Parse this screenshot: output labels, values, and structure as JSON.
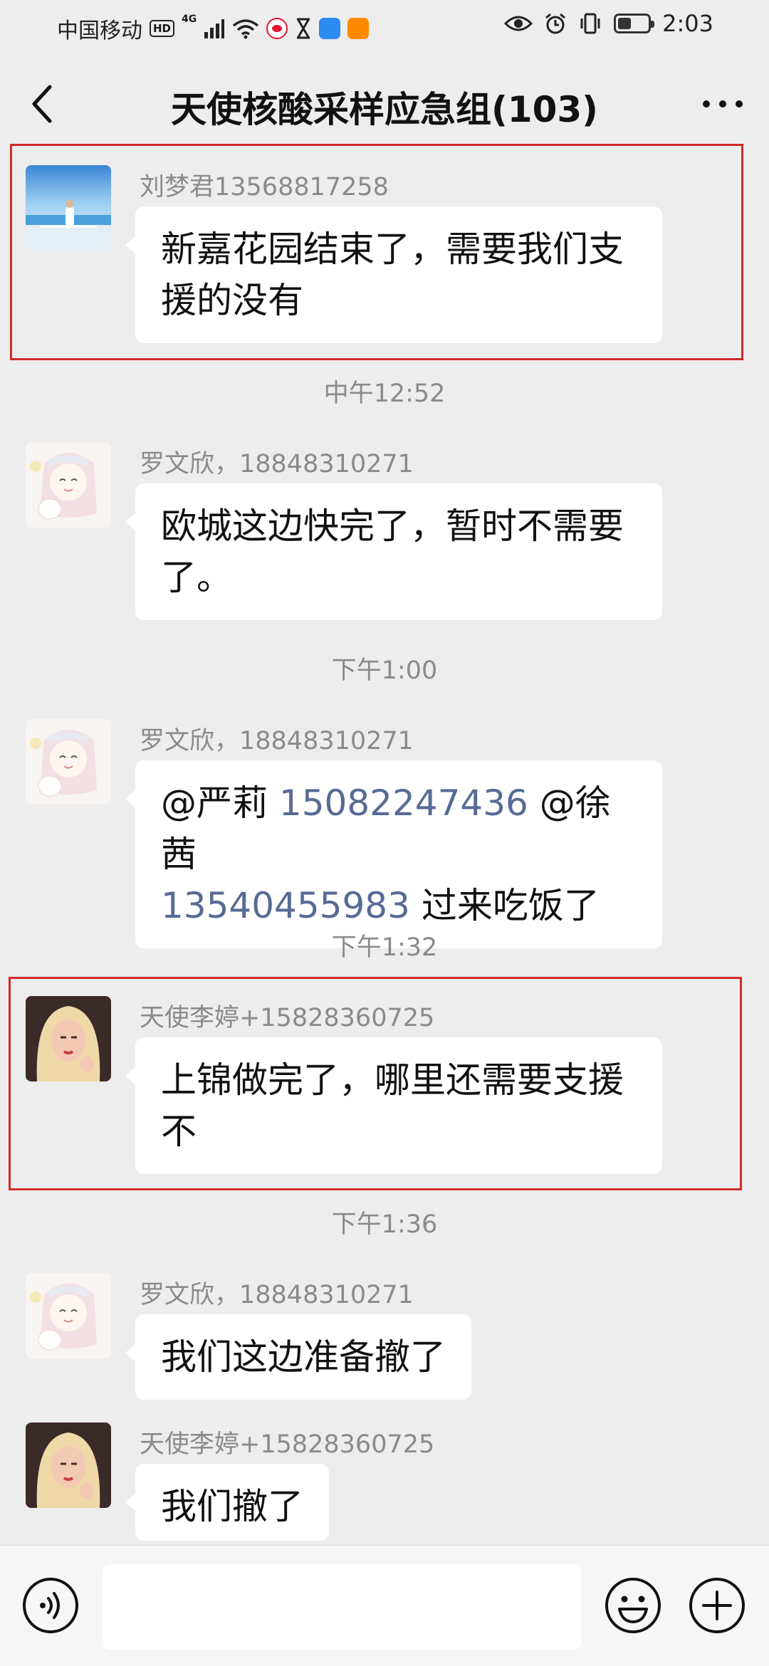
{
  "status_bar": {
    "carrier": "中国移动",
    "hd": "HD",
    "network": "4G",
    "time": "2:03",
    "battery_level": 0.45
  },
  "header": {
    "title": "天使核酸采样应急组(103)"
  },
  "messages": [
    {
      "sender": "刘梦君13568817258",
      "lines": [
        "新嘉花园结束了，需要我们支",
        "援的没有"
      ]
    },
    {
      "timestamp": "中午12:52",
      "sender": "罗文欣，18848310271",
      "lines": [
        "欧城这边快完了，暂时不需要",
        "了。"
      ]
    },
    {
      "timestamp": "下午1:00",
      "sender": "罗文欣，18848310271",
      "line1_mention": "@严莉",
      "line1_phone": "15082247436",
      "line1_mention2": "@徐茜",
      "line2_phone": "13540455983",
      "line2_text": "过来吃饭了"
    },
    {
      "timestamp": "下午1:32",
      "sender": "天使李婷+15828360725",
      "lines": [
        "上锦做完了，哪里还需要支援",
        "不"
      ]
    },
    {
      "timestamp": "下午1:36",
      "sender": "罗文欣，18848310271",
      "lines": [
        "我们这边准备撤了"
      ]
    },
    {
      "sender": "天使李婷+15828360725",
      "lines": [
        "我们撤了"
      ]
    }
  ],
  "input_bar": {
    "placeholder": ""
  },
  "icons": {
    "back": "chevron-left-icon",
    "more": "more-dots-icon",
    "voice": "voice-icon",
    "emoji": "emoji-icon",
    "plus": "plus-circle-icon"
  },
  "colors": {
    "background": "#ededed",
    "bubble": "#ffffff",
    "link": "#576b95",
    "highlight": "#d42a2a"
  }
}
